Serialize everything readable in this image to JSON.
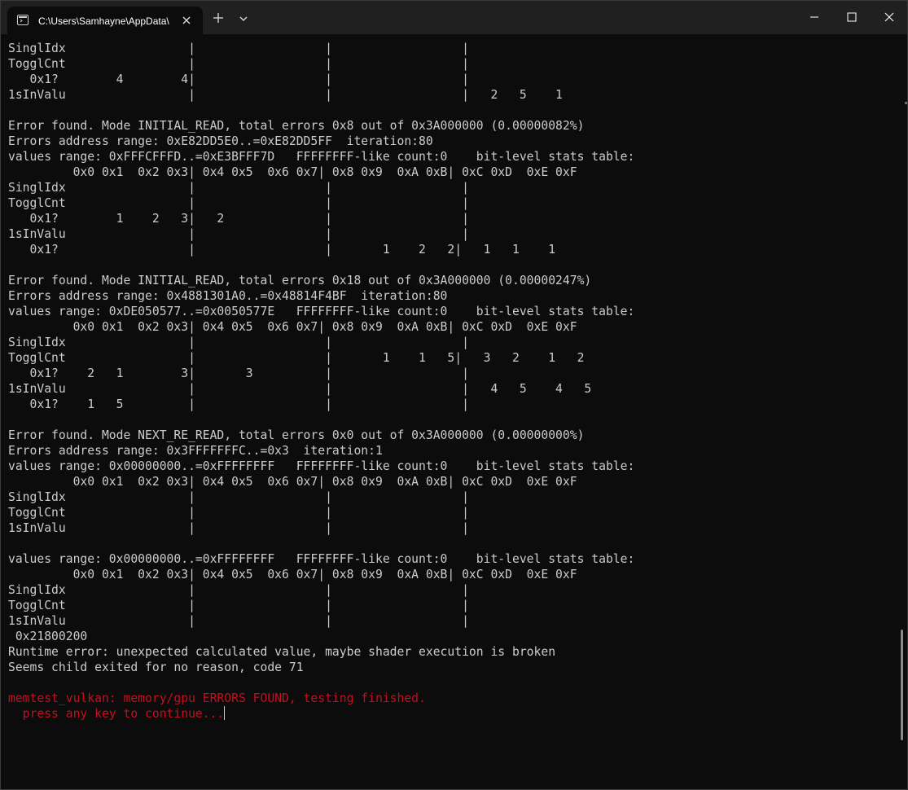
{
  "window": {
    "tab_title": "C:\\Users\\Samhayne\\AppData\\",
    "icons": {
      "tab": "terminal-icon",
      "tab_close": "close-icon",
      "new_tab": "plus-icon",
      "dropdown": "chevron-down-icon",
      "minimize": "minimize-icon",
      "maximize": "maximize-icon",
      "close": "close-icon"
    }
  },
  "colors": {
    "background": "#0c0c0c",
    "text": "#cccccc",
    "error_text": "#c50f1f",
    "titlebar": "#202020"
  },
  "terminal": {
    "lines": [
      {
        "text": "SinglIdx                 |                  |                  |"
      },
      {
        "text": "TogglCnt                 |                  |                  |"
      },
      {
        "text": "   0x1?        4        4|                  |                  |"
      },
      {
        "text": "1sInValu                 |                  |                  |   2   5    1"
      },
      {
        "text": ""
      },
      {
        "text": "Error found. Mode INITIAL_READ, total errors 0x8 out of 0x3A000000 (0.00000082%)"
      },
      {
        "text": "Errors address range: 0xE82DD5E0..=0xE82DD5FF  iteration:80"
      },
      {
        "text": "values range: 0xFFFCFFFD..=0xE3BFFF7D   FFFFFFFF-like count:0    bit-level stats table:"
      },
      {
        "text": "         0x0 0x1  0x2 0x3| 0x4 0x5  0x6 0x7| 0x8 0x9  0xA 0xB| 0xC 0xD  0xE 0xF"
      },
      {
        "text": "SinglIdx                 |                  |                  |"
      },
      {
        "text": "TogglCnt                 |                  |                  |"
      },
      {
        "text": "   0x1?        1    2   3|   2              |                  |"
      },
      {
        "text": "1sInValu                 |                  |                  |"
      },
      {
        "text": "   0x1?                  |                  |       1    2   2|   1   1    1"
      },
      {
        "text": ""
      },
      {
        "text": "Error found. Mode INITIAL_READ, total errors 0x18 out of 0x3A000000 (0.00000247%)"
      },
      {
        "text": "Errors address range: 0x4881301A0..=0x48814F4BF  iteration:80"
      },
      {
        "text": "values range: 0xDE050577..=0x0050577E   FFFFFFFF-like count:0    bit-level stats table:"
      },
      {
        "text": "         0x0 0x1  0x2 0x3| 0x4 0x5  0x6 0x7| 0x8 0x9  0xA 0xB| 0xC 0xD  0xE 0xF"
      },
      {
        "text": "SinglIdx                 |                  |                  |"
      },
      {
        "text": "TogglCnt                 |                  |       1    1   5|   3   2    1   2"
      },
      {
        "text": "   0x1?    2   1        3|       3          |                  |"
      },
      {
        "text": "1sInValu                 |                  |                  |   4   5    4   5"
      },
      {
        "text": "   0x1?    1   5         |                  |                  |"
      },
      {
        "text": ""
      },
      {
        "text": "Error found. Mode NEXT_RE_READ, total errors 0x0 out of 0x3A000000 (0.00000000%)"
      },
      {
        "text": "Errors address range: 0x3FFFFFFFC..=0x3  iteration:1"
      },
      {
        "text": "values range: 0x00000000..=0xFFFFFFFF   FFFFFFFF-like count:0    bit-level stats table:"
      },
      {
        "text": "         0x0 0x1  0x2 0x3| 0x4 0x5  0x6 0x7| 0x8 0x9  0xA 0xB| 0xC 0xD  0xE 0xF"
      },
      {
        "text": "SinglIdx                 |                  |                  |"
      },
      {
        "text": "TogglCnt                 |                  |                  |"
      },
      {
        "text": "1sInValu                 |                  |                  |"
      },
      {
        "text": ""
      },
      {
        "text": "values range: 0x00000000..=0xFFFFFFFF   FFFFFFFF-like count:0    bit-level stats table:"
      },
      {
        "text": "         0x0 0x1  0x2 0x3| 0x4 0x5  0x6 0x7| 0x8 0x9  0xA 0xB| 0xC 0xD  0xE 0xF"
      },
      {
        "text": "SinglIdx                 |                  |                  |"
      },
      {
        "text": "TogglCnt                 |                  |                  |"
      },
      {
        "text": "1sInValu                 |                  |                  |"
      },
      {
        "text": " 0x21800200"
      },
      {
        "text": "Runtime error: unexpected calculated value, maybe shader execution is broken"
      },
      {
        "text": "Seems child exited for no reason, code 71"
      },
      {
        "text": ""
      },
      {
        "text": "memtest_vulkan: memory/gpu ERRORS FOUND, testing finished.",
        "style": "error"
      },
      {
        "text": "  press any key to continue...",
        "style": "error",
        "cursor": true
      }
    ]
  }
}
